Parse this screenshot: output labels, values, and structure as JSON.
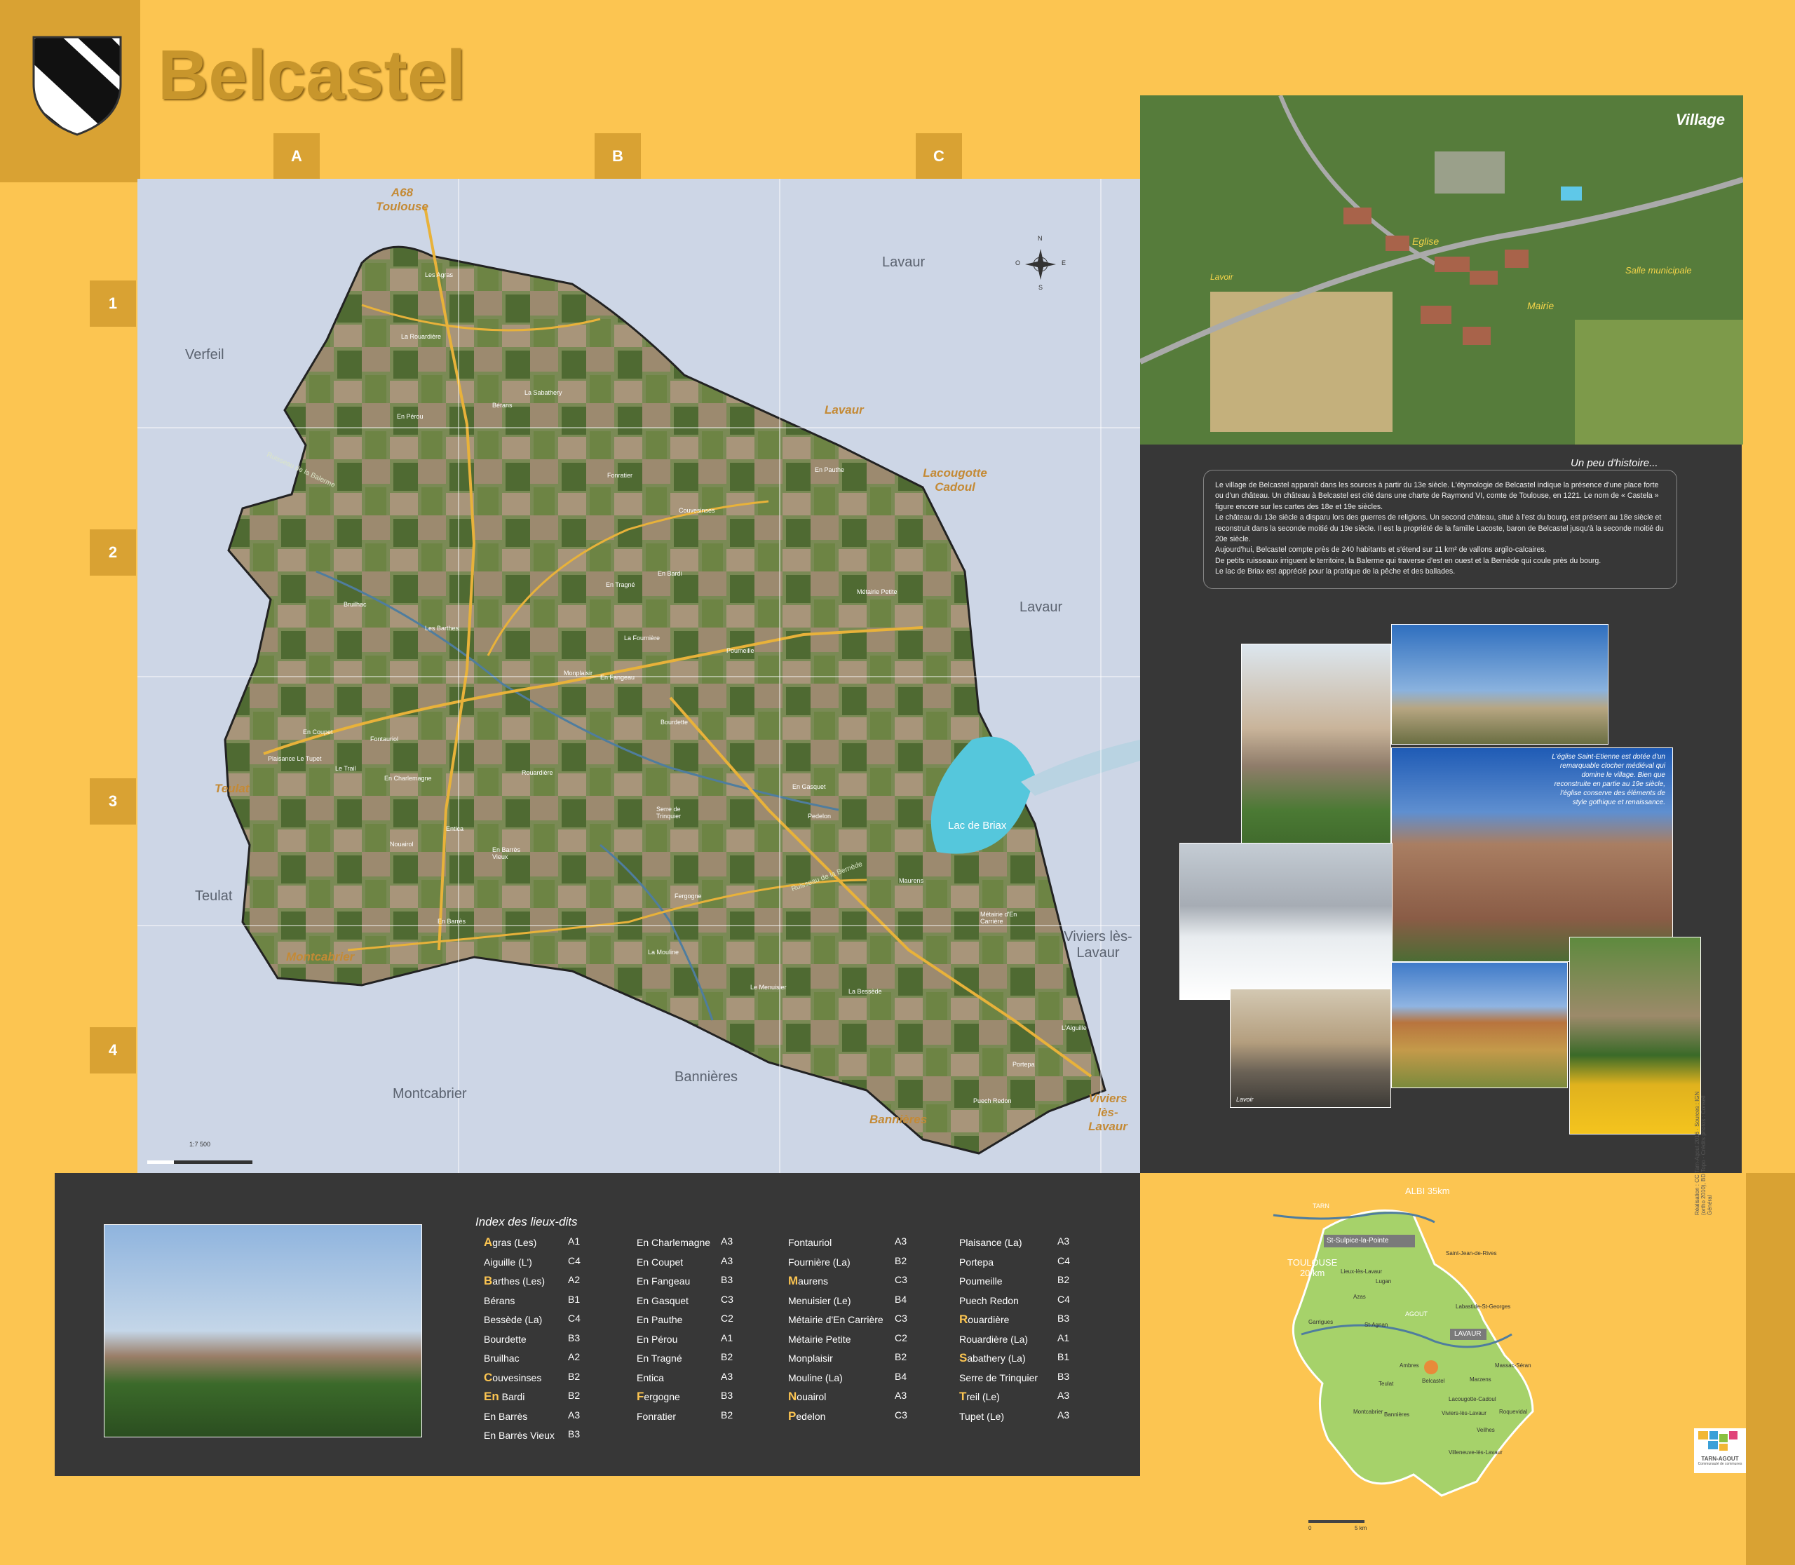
{
  "title": "Belcastel",
  "columns": [
    "A",
    "B",
    "C"
  ],
  "rows": [
    "1",
    "2",
    "3",
    "4"
  ],
  "map": {
    "towns": [
      "Verfeil",
      "Lavaur",
      "Lavaur",
      "Teulat",
      "Montcabrier",
      "Bannières",
      "Viviers lès-Lavaur"
    ],
    "destinations": {
      "a68": "A68",
      "toulouse": "Toulouse",
      "lavaur": "Lavaur",
      "lacougotte": "Lacougotte Cadoul",
      "teulat": "Teulat",
      "montcabrier": "Montcabrier",
      "bannieres": "Bannières",
      "viviers": "Viviers lès-Lavaur"
    },
    "lake": "Lac de Briax",
    "compass": {
      "n": "N",
      "s": "S",
      "e": "E",
      "o": "O"
    },
    "scale": "1:7 500",
    "places": [
      "Les Agras",
      "La Rouardière",
      "La Sabathery",
      "Bérans",
      "En Pérou",
      "Fonratier",
      "Couvesinses",
      "En Pauthe",
      "En Bardi",
      "En Tragné",
      "Métairie Petite",
      "Bruilhac",
      "Les Barthes",
      "La Fournière",
      "Poumeille",
      "Monplaisir",
      "En Fangeau",
      "Bourdette",
      "En Coupet",
      "Fontauriol",
      "Plaisance Le Tupet",
      "Le Trail",
      "En Charlemagne",
      "Rouardière",
      "En Gasquet",
      "Pedelon",
      "Serre de Trinquier",
      "Entica",
      "Nouairol",
      "En Barrès Vieux",
      "Fergogne",
      "Maurens",
      "Métairie d'En Carrière",
      "En Barrès",
      "La Mouline",
      "Le Menuisier",
      "La Bessède",
      "L'Aiguille",
      "Portepa",
      "Puech Redon"
    ],
    "streams": [
      "Ruisseau de la Balerme",
      "Ruisseau de la Bernède"
    ]
  },
  "village": {
    "title": "Village",
    "labels": {
      "eglise": "Eglise",
      "mairie": "Mairie",
      "salle": "Salle municipale",
      "lavoir": "Lavoir"
    }
  },
  "history": {
    "title": "Un peu d'histoire...",
    "paragraphs": [
      "Le village de Belcastel apparaît dans les sources à partir du 13e siècle. L'étymologie de Belcastel indique la présence d'une place forte ou d'un château. Un château à Belcastel est cité dans une charte de Raymond VI, comte de Toulouse, en 1221. Le nom de « Castela » figure encore sur les cartes des 18e et 19e siècles.",
      "Le château du 13e siècle a disparu lors des guerres de religions. Un second château, situé à l'est du bourg, est présent au 18e siècle et reconstruit dans la seconde moitié du 19e siècle. Il est la propriété de la famille Lacoste, baron de Belcastel jusqu'à la seconde moitié du 20e siècle.",
      "Aujourd'hui, Belcastel compte près de 240 habitants et s'étend sur 11 km² de vallons argilo-calcaires.",
      "De petits ruisseaux irriguent le territoire, la Balerme qui traverse d'est en ouest et la Bernède qui coule près du bourg.",
      "Le lac de Briax est apprécié pour la pratique de la pêche et des ballades."
    ]
  },
  "church_caption": "L'église Saint-Etienne est dotée d'un remarquable clocher médiéval qui domine le village. Bien que reconstruite en partie au 19e siècle, l'église conserve des éléments de style gothique et renaissance.",
  "lavoir_caption": "Lavoir",
  "index": {
    "title": "Index des lieux-dits",
    "columns": [
      [
        [
          "A",
          "gras (Les)",
          "A1"
        ],
        [
          "",
          "Aiguille (L')",
          "C4"
        ],
        [
          "B",
          "arthes (Les)",
          "A2"
        ],
        [
          "",
          "Bérans",
          "B1"
        ],
        [
          "",
          "Bessède (La)",
          "C4"
        ],
        [
          "",
          "Bourdette",
          "B3"
        ],
        [
          "",
          "Bruilhac",
          "A2"
        ],
        [
          "C",
          "ouvesinses",
          "B2"
        ],
        [
          "En",
          " Bardi",
          "B2"
        ],
        [
          "",
          "En Barrès",
          "A3"
        ],
        [
          "",
          "En Barrès Vieux",
          "B3"
        ]
      ],
      [
        [
          "",
          "En Charlemagne",
          "A3"
        ],
        [
          "",
          "En Coupet",
          "A3"
        ],
        [
          "",
          "En Fangeau",
          "B3"
        ],
        [
          "",
          "En Gasquet",
          "C3"
        ],
        [
          "",
          "En Pauthe",
          "C2"
        ],
        [
          "",
          "En Pérou",
          "A1"
        ],
        [
          "",
          "En Tragné",
          "B2"
        ],
        [
          "",
          "Entica",
          "A3"
        ],
        [
          "F",
          "ergogne",
          "B3"
        ],
        [
          "",
          "Fonratier",
          "B2"
        ]
      ],
      [
        [
          "",
          "Fontauriol",
          "A3"
        ],
        [
          "",
          "Fournière (La)",
          "B2"
        ],
        [
          "M",
          "aurens",
          "C3"
        ],
        [
          "",
          "Menuisier (Le)",
          "B4"
        ],
        [
          "",
          "Métairie d'En Carrière",
          "C3"
        ],
        [
          "",
          "Métairie Petite",
          "C2"
        ],
        [
          "",
          "Monplaisir",
          "B2"
        ],
        [
          "",
          "Mouline (La)",
          "B4"
        ],
        [
          "N",
          "ouairol",
          "A3"
        ],
        [
          "P",
          "edelon",
          "C3"
        ]
      ],
      [
        [
          "",
          "Plaisance (La)",
          "A3"
        ],
        [
          "",
          "Portepa",
          "C4"
        ],
        [
          "",
          "Poumeille",
          "B2"
        ],
        [
          "",
          "Puech Redon",
          "C4"
        ],
        [
          "R",
          "ouardière",
          "B3"
        ],
        [
          "",
          "Rouardière (La)",
          "A1"
        ],
        [
          "S",
          "abathery (La)",
          "B1"
        ],
        [
          "",
          "Serre de Trinquier",
          "B3"
        ],
        [
          "T",
          "reil (Le)",
          "A3"
        ],
        [
          "",
          "Tupet (Le)",
          "A3"
        ]
      ]
    ]
  },
  "locator": {
    "albi": "ALBI 35km",
    "toulouse": "TOULOUSE",
    "toulouse_km": "20 km",
    "tarn": "TARN",
    "agout": "AGOUT",
    "st_sulpice": "St-Sulpice-la-Pointe",
    "lavaur": "LAVAUR",
    "communes": [
      "Lieux-lès-Lavaur",
      "Saint-Jean-de-Rives",
      "Lugan",
      "Azas",
      "Garrigues",
      "St-Agnan",
      "Labastide-St-Georges",
      "Marzens",
      "Massac-Séran",
      "Belcastel",
      "Teulat",
      "Lacougotte-Cadoul",
      "Ambres",
      "Montcabrier",
      "Bannières",
      "Viviers-lès-Lavaur",
      "Veilhes",
      "Villeneuve-lès-Lavaur",
      "Roquevidal"
    ],
    "scale0": "0",
    "scale5": "5 km"
  },
  "logo": {
    "name": "TARN-AGOUT",
    "sub": "Communauté de communes"
  },
  "credits": "Réalisation : CC Tarn-Agout 2016 · Sources : IGN (ortho 2010), BD Topo · Crédits photos : Conseil Général"
}
